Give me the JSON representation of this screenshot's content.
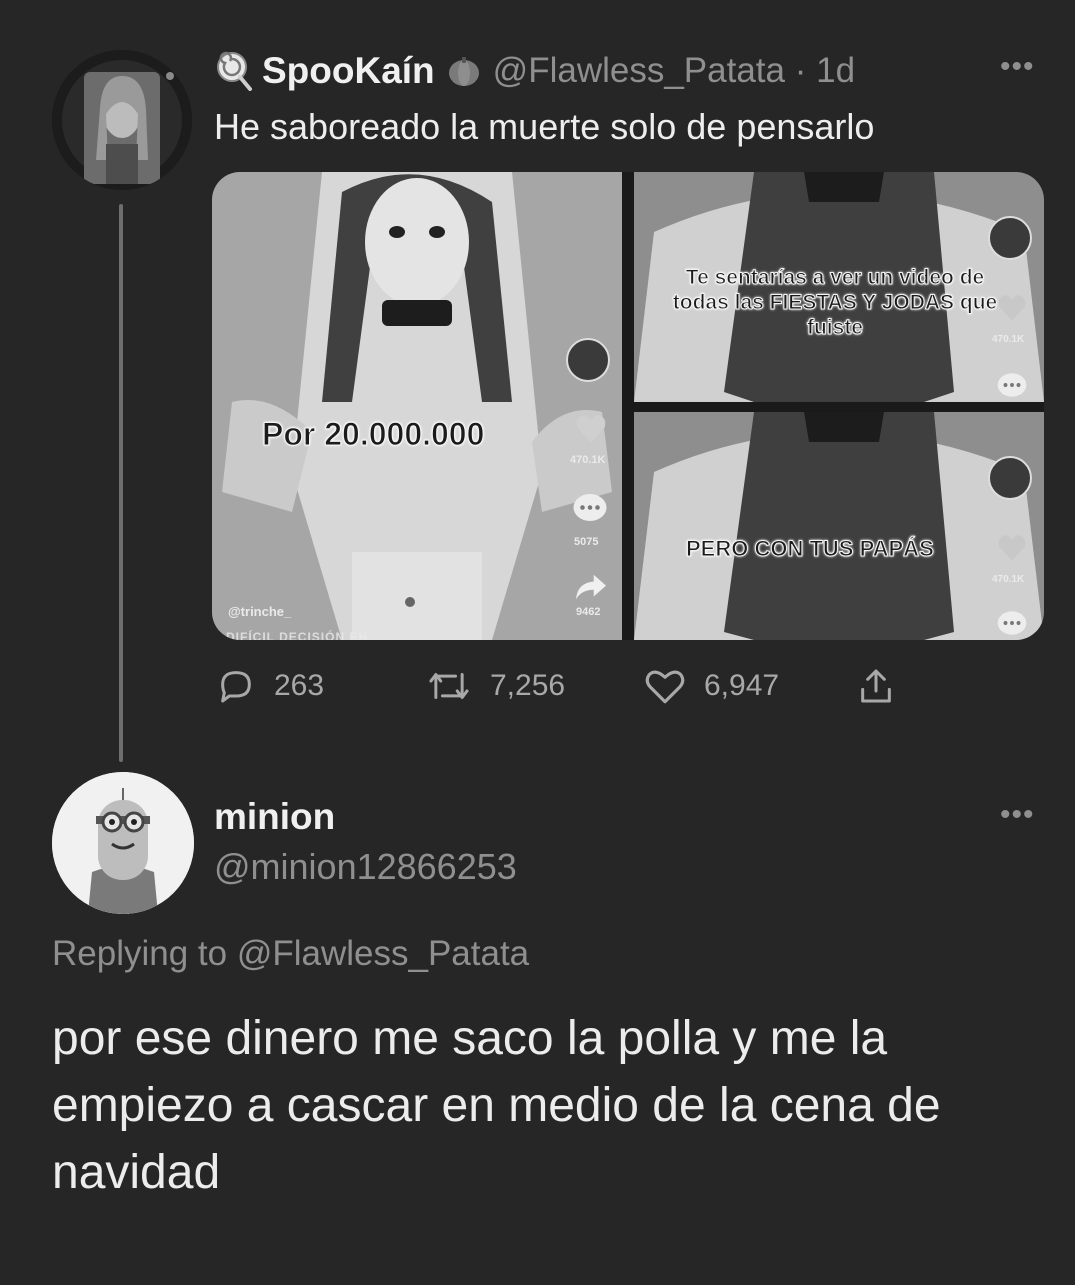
{
  "tweet": {
    "author": {
      "display_name": "SpooKaín",
      "handle": "@Flawless_Patata",
      "time": "1d"
    },
    "text": "He saboreado la muerte solo de pensarlo",
    "media": {
      "left": {
        "caption": "Por 20.000.000",
        "user": "@trinche_",
        "bottom_text": "DIFÍCIL DECISIÓN EH",
        "likes": "470.1K",
        "comments": "5075",
        "shares": "9462"
      },
      "top_right": {
        "caption": "Te sentarías a ver un video de todas las FIESTAS Y JODAS que fuiste",
        "likes": "470.1K"
      },
      "bottom_right": {
        "caption": "PERO CON TUS PAPÁS",
        "likes": "470.1K"
      }
    },
    "stats": {
      "replies": "263",
      "retweets": "7,256",
      "likes": "6,947"
    },
    "icons": [
      "lollipop-icon",
      "pumpkin-icon",
      "more-icon",
      "reply-icon",
      "retweet-icon",
      "like-icon",
      "share-icon"
    ]
  },
  "reply": {
    "author": {
      "display_name": "minion",
      "handle": "@minion12866253"
    },
    "replying_to": "Replying to @Flawless_Patata",
    "text": "por ese dinero me saco la polla y me la empiezo a cascar en medio de la cena de navidad"
  },
  "ui": {
    "more_glyph": "•••",
    "time_sep": "·"
  }
}
